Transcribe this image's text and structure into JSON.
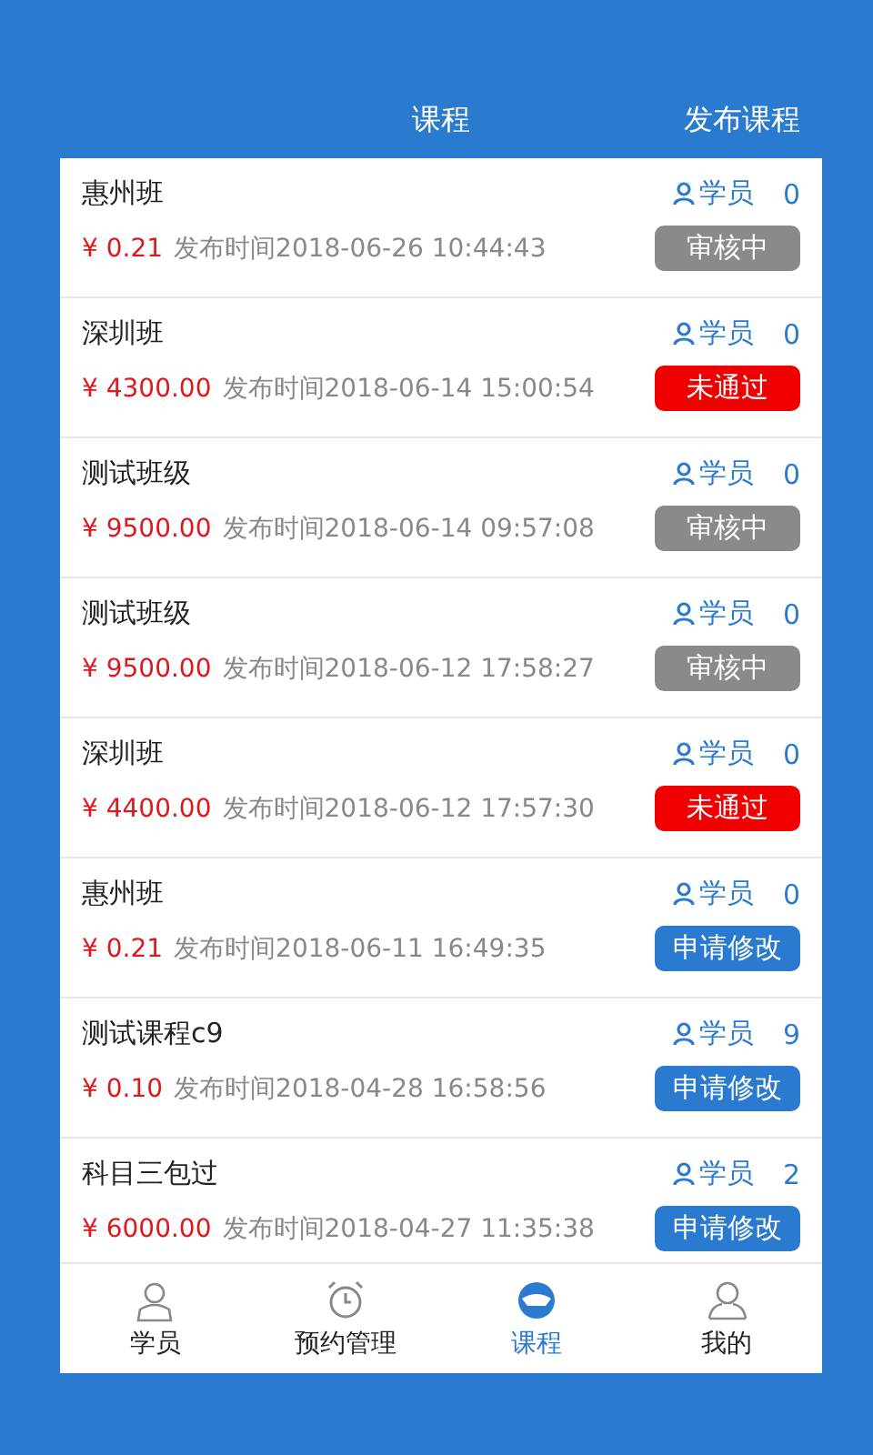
{
  "header": {
    "title": "课程",
    "action": "发布课程"
  },
  "courses": [
    {
      "name": "惠州班",
      "price": "¥ 0.21",
      "published": "发布时间2018-06-26 10:44:43",
      "students_label": "学员",
      "students": "0",
      "status": {
        "kind": "pending",
        "label": "审核中"
      }
    },
    {
      "name": "深圳班",
      "price": "¥ 4300.00",
      "published": "发布时间2018-06-14 15:00:54",
      "students_label": "学员",
      "students": "0",
      "status": {
        "kind": "rejected",
        "label": "未通过"
      }
    },
    {
      "name": "测试班级",
      "price": "¥ 9500.00",
      "published": "发布时间2018-06-14 09:57:08",
      "students_label": "学员",
      "students": "0",
      "status": {
        "kind": "pending",
        "label": "审核中"
      }
    },
    {
      "name": "测试班级",
      "price": "¥ 9500.00",
      "published": "发布时间2018-06-12 17:58:27",
      "students_label": "学员",
      "students": "0",
      "status": {
        "kind": "pending",
        "label": "审核中"
      }
    },
    {
      "name": "深圳班",
      "price": "¥ 4400.00",
      "published": "发布时间2018-06-12 17:57:30",
      "students_label": "学员",
      "students": "0",
      "status": {
        "kind": "rejected",
        "label": "未通过"
      }
    },
    {
      "name": "惠州班",
      "price": "¥ 0.21",
      "published": "发布时间2018-06-11 16:49:35",
      "students_label": "学员",
      "students": "0",
      "status": {
        "kind": "edit",
        "label": "申请修改"
      }
    },
    {
      "name": "测试课程c9",
      "price": "¥ 0.10",
      "published": "发布时间2018-04-28 16:58:56",
      "students_label": "学员",
      "students": "9",
      "status": {
        "kind": "edit",
        "label": "申请修改"
      }
    },
    {
      "name": "科目三包过",
      "price": "¥ 6000.00",
      "published": "发布时间2018-04-27 11:35:38",
      "students_label": "学员",
      "students": "2",
      "status": {
        "kind": "edit",
        "label": "申请修改"
      }
    }
  ],
  "tabs": [
    {
      "kind": "student",
      "label": "学员",
      "selected": false
    },
    {
      "kind": "alarm",
      "label": "预约管理",
      "selected": false
    },
    {
      "kind": "wheel",
      "label": "课程",
      "selected": true
    },
    {
      "kind": "user",
      "label": "我的",
      "selected": false
    }
  ]
}
